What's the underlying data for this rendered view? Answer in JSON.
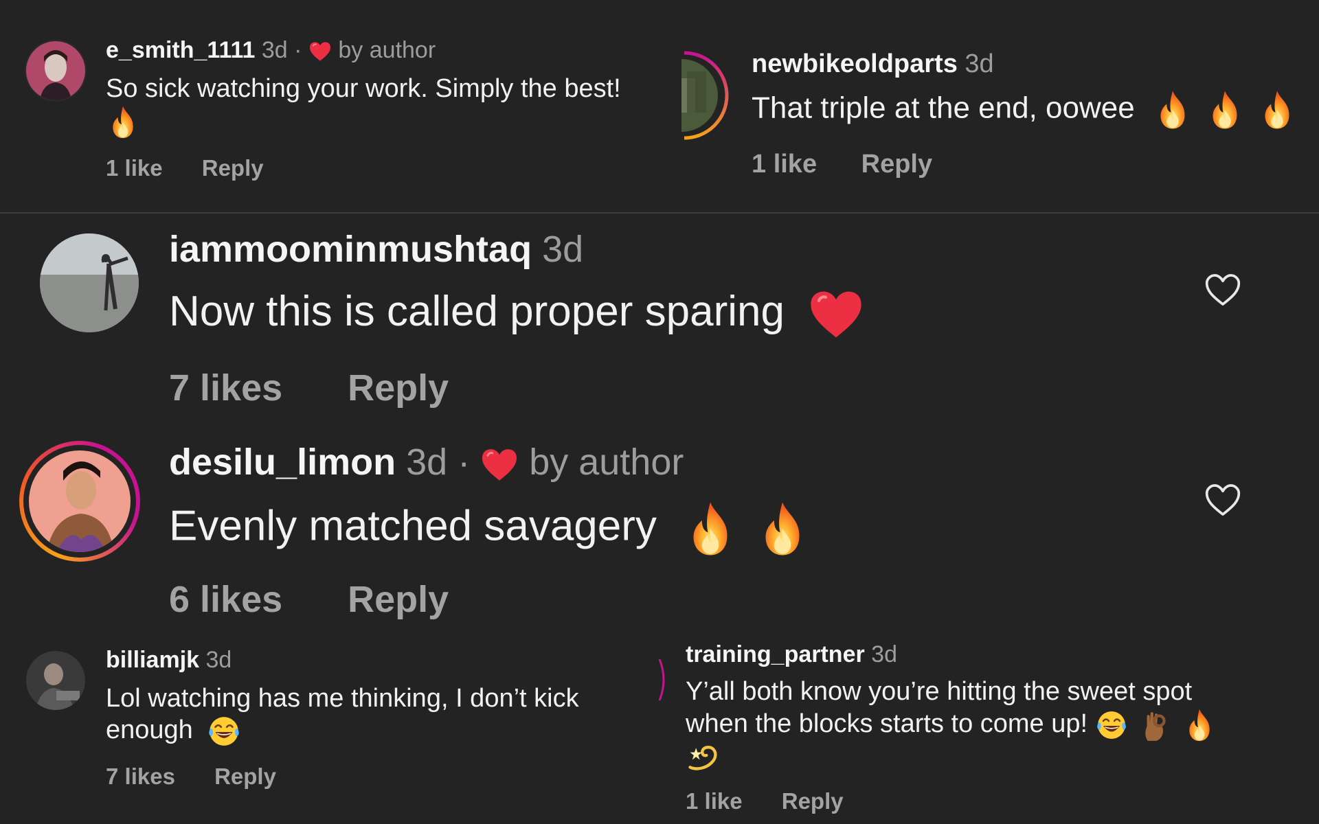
{
  "comments": [
    {
      "username": "e_smith_1111",
      "time": "3d",
      "dot": "·",
      "liked_by_author": "by author",
      "text_line1": "So sick watching your work. Simply the best!",
      "emojis": [
        "fire"
      ],
      "likes": "1 like",
      "reply": "Reply"
    },
    {
      "username": "newbikeoldparts",
      "time": "3d",
      "text": "That triple at the end, oowee",
      "emojis": [
        "fire",
        "fire",
        "fire"
      ],
      "likes": "1 like",
      "reply": "Reply"
    },
    {
      "username": "iammoominmushtaq",
      "time": "3d",
      "text": "Now this is called proper sparing",
      "emojis": [
        "red-heart"
      ],
      "likes": "7 likes",
      "reply": "Reply"
    },
    {
      "username": "desilu_limon",
      "time": "3d",
      "dot": "·",
      "liked_by_author": "by author",
      "text": "Evenly matched savagery",
      "emojis": [
        "fire",
        "fire"
      ],
      "likes": "6 likes",
      "reply": "Reply"
    },
    {
      "username": "billiamjk",
      "time": "3d",
      "text_line1": "Lol watching has me thinking, I don’t kick",
      "text_line2": "enough",
      "emojis": [
        "tears-of-joy"
      ],
      "likes": "7 likes",
      "reply": "Reply"
    },
    {
      "username": "training_partner",
      "time": "3d",
      "text_line1": "Y’all both know you’re hitting the sweet spot",
      "text_line2": "when the blocks  starts to come up!",
      "emojis": [
        "tears-of-joy",
        "ok-hand",
        "fire",
        "dizzy"
      ],
      "likes": "1 like",
      "reply": "Reply"
    }
  ],
  "colors": {
    "background": "#232324",
    "heart_red": "#ed2f43",
    "ring_pink": "#c7138f",
    "ring_orange": "#f7a21b",
    "muted_text": "#9d9d9d"
  },
  "icons": {
    "like_button": "heart-outline-icon",
    "author_like": "red-heart-icon"
  }
}
